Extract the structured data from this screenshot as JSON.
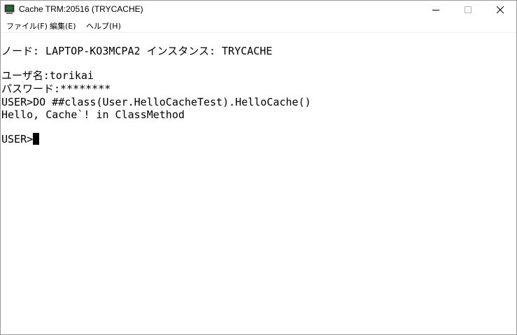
{
  "window": {
    "title": "Cache TRM:20516 (TRYCACHE)"
  },
  "menu": {
    "items": [
      "ファイル(F)",
      "編集(E)",
      "ヘルプ(H)"
    ]
  },
  "terminal": {
    "lines": [
      "ノード: LAPTOP-KO3MCPA2 インスタンス: TRYCACHE",
      "ユーザ名:torikai",
      "パスワード:********",
      "USER>DO ##class(User.HelloCacheTest).HelloCache()",
      "Hello, Cache`! in ClassMethod",
      "USER>"
    ]
  },
  "colors": {
    "background": "#ffffff",
    "text": "#000000"
  },
  "icons": {
    "app": "terminal-icon",
    "minimize": "minimize-icon",
    "maximize": "maximize-icon",
    "close": "close-icon"
  }
}
